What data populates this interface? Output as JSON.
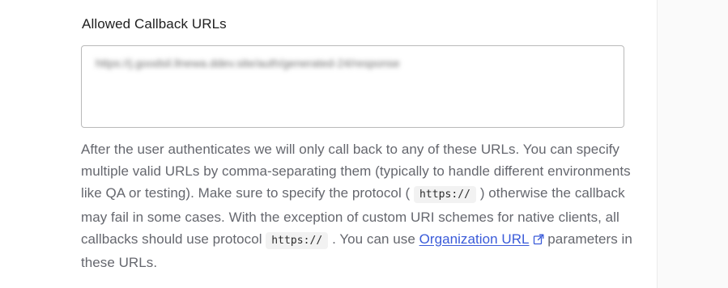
{
  "field": {
    "label": "Allowed Callback URLs",
    "value": "https://j.goodsil.llnewa.ddev.site/auth/generated-24/response"
  },
  "help": {
    "part1": "After the user authenticates we will only call back to any of these URLs. You can specify multiple valid URLs by comma-separating them (typically to handle different environments like QA or testing). Make sure to specify the protocol ( ",
    "code1": "https://",
    "part2": " ) otherwise the callback may fail in some cases. With the exception of custom URI schemes for native clients, all callbacks should use protocol ",
    "code2": "https://",
    "part3": " . You can use ",
    "link_label": "Organization URL",
    "part4": " parameters in these URLs.",
    "link_icon": "external-link-icon"
  },
  "colors": {
    "link": "#3a5bd9",
    "help_text": "#65676e",
    "label_text": "#1f1f1f",
    "border": "#b9b9b9"
  }
}
